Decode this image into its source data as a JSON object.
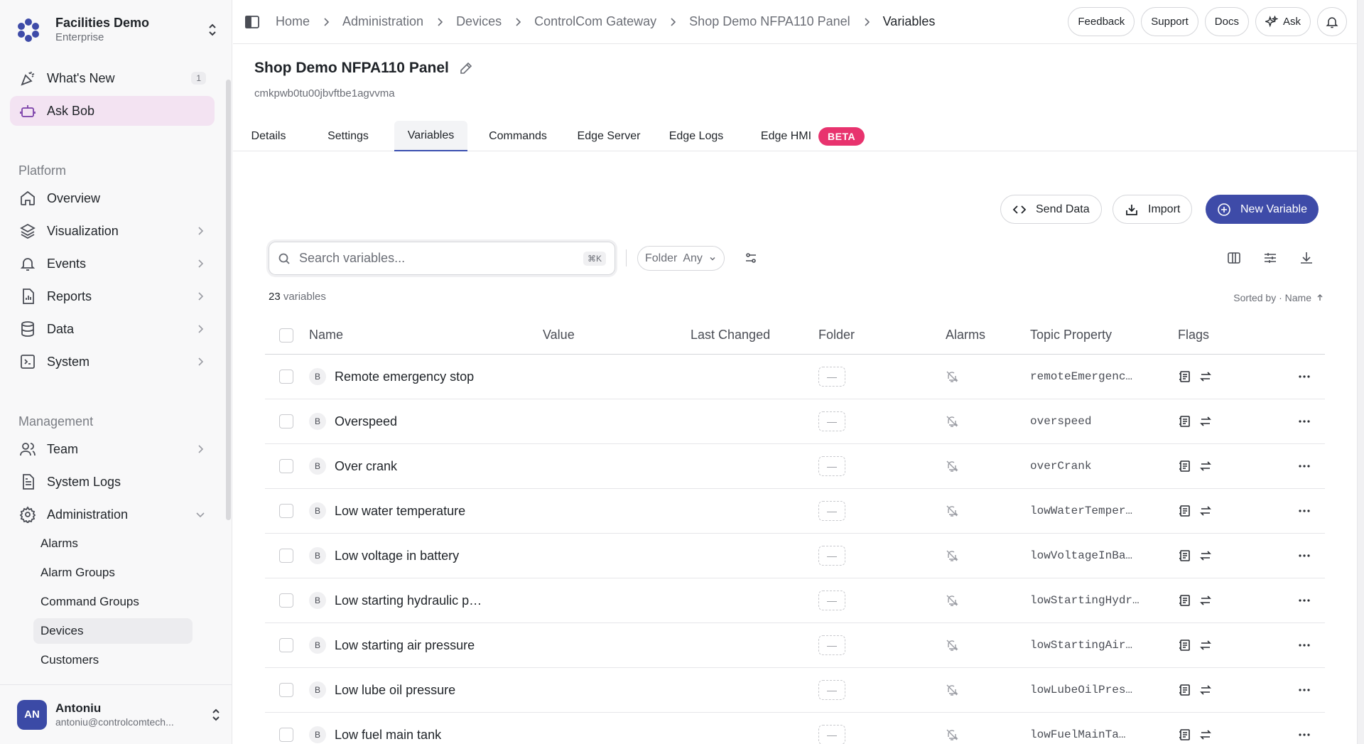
{
  "org": {
    "name": "Facilities Demo",
    "plan": "Enterprise"
  },
  "sidebar": {
    "top_items": [
      {
        "label": "What's New",
        "badge": "1"
      },
      {
        "label": "Ask Bob"
      }
    ],
    "platform_label": "Platform",
    "platform_items": [
      {
        "label": "Overview"
      },
      {
        "label": "Visualization"
      },
      {
        "label": "Events"
      },
      {
        "label": "Reports"
      },
      {
        "label": "Data"
      },
      {
        "label": "System"
      }
    ],
    "management_label": "Management",
    "management_items": [
      {
        "label": "Team"
      },
      {
        "label": "System Logs"
      },
      {
        "label": "Administration"
      }
    ],
    "admin_sub_items": [
      {
        "label": "Alarms"
      },
      {
        "label": "Alarm Groups"
      },
      {
        "label": "Command Groups"
      },
      {
        "label": "Devices"
      },
      {
        "label": "Customers"
      }
    ]
  },
  "user": {
    "initials": "AN",
    "name": "Antoniu",
    "email": "antoniu@controlcomtech..."
  },
  "breadcrumb": [
    "Home",
    "Administration",
    "Devices",
    "ControlCom Gateway",
    "Shop Demo NFPA110 Panel",
    "Variables"
  ],
  "top_actions": {
    "feedback": "Feedback",
    "support": "Support",
    "docs": "Docs",
    "ask": "Ask"
  },
  "page": {
    "title": "Shop Demo NFPA110 Panel",
    "device_id": "cmkpwb0tu00jbvftbe1agvvma"
  },
  "tabs": [
    "Details",
    "Settings",
    "Variables",
    "Commands",
    "Edge Server",
    "Edge Logs",
    "Edge HMI"
  ],
  "beta_label": "BETA",
  "actions": {
    "send_data": "Send Data",
    "import": "Import",
    "new_variable": "New Variable"
  },
  "search": {
    "placeholder": "Search variables...",
    "shortcut": "⌘K"
  },
  "folder_filter": {
    "label": "Folder",
    "value": "Any"
  },
  "summary": {
    "count": "23",
    "count_label": "variables",
    "sorted_by": "Sorted by · Name"
  },
  "table": {
    "headers": [
      "Name",
      "Value",
      "Last Changed",
      "Folder",
      "Alarms",
      "Topic Property",
      "Flags"
    ],
    "rows": [
      {
        "type": "B",
        "name": "Remote emergency stop",
        "folder": "—",
        "topic": "remoteEmergenc…"
      },
      {
        "type": "B",
        "name": "Overspeed",
        "folder": "—",
        "topic": "overspeed"
      },
      {
        "type": "B",
        "name": "Over crank",
        "folder": "—",
        "topic": "overCrank"
      },
      {
        "type": "B",
        "name": "Low water temperature",
        "folder": "—",
        "topic": "lowWaterTemper…"
      },
      {
        "type": "B",
        "name": "Low voltage in battery",
        "folder": "—",
        "topic": "lowVoltageInBa…"
      },
      {
        "type": "B",
        "name": "Low starting hydraulic p…",
        "folder": "—",
        "topic": "lowStartingHydr…"
      },
      {
        "type": "B",
        "name": "Low starting air pressure",
        "folder": "—",
        "topic": "lowStartingAir…"
      },
      {
        "type": "B",
        "name": "Low lube oil pressure",
        "folder": "—",
        "topic": "lowLubeOilPres…"
      },
      {
        "type": "B",
        "name": "Low fuel main tank",
        "folder": "—",
        "topic": "lowFuelMainTa…"
      }
    ]
  },
  "colors": {
    "accent": "#3e4ba8",
    "beta": "#e8336e",
    "active_nav": "#f3e3f2"
  }
}
